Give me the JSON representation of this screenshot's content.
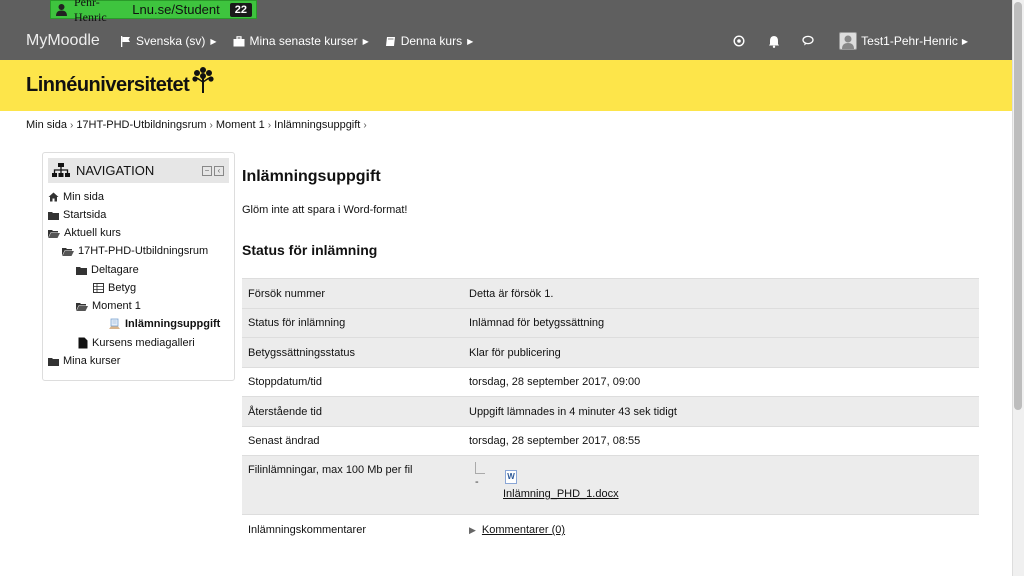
{
  "topbar": {
    "user_name": "Pehr-Henric",
    "institution": "Lnu.se/Student",
    "badge_count": "22"
  },
  "navbar": {
    "brand": "MyMoodle",
    "items": [
      {
        "label": "Svenska (sv)",
        "icon": "flag-icon"
      },
      {
        "label": "Mina senaste kurser",
        "icon": "briefcase-icon"
      },
      {
        "label": "Denna kurs",
        "icon": "book-icon"
      }
    ],
    "user_label": "Test1-Pehr-Henric"
  },
  "header": {
    "logo_text": "Linnéuniversitetet"
  },
  "breadcrumb": [
    "Min sida",
    "17HT-PHD-Utbildningsrum",
    "Moment 1",
    "Inlämningsuppgift"
  ],
  "navigation": {
    "title": "NAVIGATION",
    "items": [
      {
        "label": "Min sida",
        "icon": "home-icon"
      },
      {
        "label": "Startsida",
        "icon": "folder-icon"
      },
      {
        "label": "Aktuell kurs",
        "icon": "folder-open-icon"
      },
      {
        "label": "17HT-PHD-Utbildningsrum",
        "icon": "folder-open-icon"
      },
      {
        "label": "Deltagare",
        "icon": "folder-icon"
      },
      {
        "label": "Betyg",
        "icon": "table-icon"
      },
      {
        "label": "Moment 1",
        "icon": "folder-open-icon"
      },
      {
        "label": "Inlämningsuppgift",
        "icon": "assignment-icon"
      },
      {
        "label": "Kursens mediagalleri",
        "icon": "file-icon"
      },
      {
        "label": "Mina kurser",
        "icon": "folder-icon"
      }
    ]
  },
  "main": {
    "title": "Inlämningsuppgift",
    "description": "Glöm inte att spara i Word-format!",
    "status_heading": "Status för inlämning",
    "rows": [
      {
        "key": "Försök nummer",
        "value": "Detta är försök 1."
      },
      {
        "key": "Status för inlämning",
        "value": "Inlämnad för betygssättning"
      },
      {
        "key": "Betygssättningsstatus",
        "value": "Klar för publicering"
      },
      {
        "key": "Stoppdatum/tid",
        "value": "torsdag, 28 september 2017, 09:00"
      },
      {
        "key": "Återstående tid",
        "value": "Uppgift lämnades in 4 minuter 43 sek tidigt"
      },
      {
        "key": "Senast ändrad",
        "value": "torsdag, 28 september 2017, 08:55"
      }
    ],
    "file_row": {
      "key": "Filinlämningar, max 100 Mb per fil",
      "dash": "-",
      "file_name": "Inlämning_PHD_1.docx"
    },
    "comment_row": {
      "key": "Inlämningskommentarer",
      "link": "Kommentarer (0)"
    }
  }
}
